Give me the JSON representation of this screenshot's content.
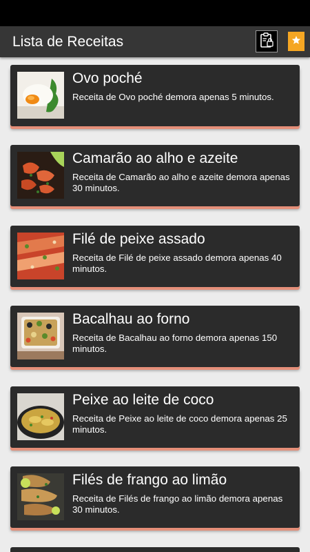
{
  "appbar": {
    "title": "Lista de Receitas",
    "policy_icon": "clipboard-lock-icon",
    "favorite_icon": "bookmark-star-icon",
    "accent_color": "#f5a623"
  },
  "recipes": [
    {
      "title": "Ovo poché",
      "description": "Receita de Ovo poché demora apenas 5 minutos.",
      "image": "poached-egg-photo"
    },
    {
      "title": "Camarão ao alho e azeite",
      "description": "Receita de Camarão ao alho e azeite demora apenas 30 minutos.",
      "image": "garlic-shrimp-photo"
    },
    {
      "title": "Filé de peixe assado",
      "description": "Receita de Filé de peixe assado demora apenas 40 minutos.",
      "image": "baked-fish-photo"
    },
    {
      "title": "Bacalhau ao forno",
      "description": "Receita de Bacalhau ao forno demora apenas 150 minutos.",
      "image": "baked-codfish-photo"
    },
    {
      "title": "Peixe ao leite de coco",
      "description": "Receita de Peixe ao leite de coco demora apenas 25 minutos.",
      "image": "coconut-fish-photo"
    },
    {
      "title": "Filés de frango ao limão",
      "description": "Receita de Filés de frango ao limão demora apenas 30 minutos.",
      "image": "lemon-chicken-photo"
    }
  ]
}
